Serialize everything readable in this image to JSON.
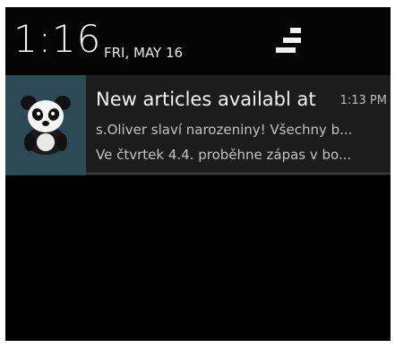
{
  "status": {
    "time": "1:16",
    "date": "FRI, MAY 16"
  },
  "notification": {
    "icon": "panda-icon",
    "title": "New articles availabl at",
    "time": "1:13 PM",
    "lines": [
      "s.Oliver slaví narozeniny! Všechny b...",
      "Ve čtvrtek 4.4. proběhne zápas v bo..."
    ]
  },
  "colors": {
    "background": "#000000",
    "notification_bg": "#1c1c1c",
    "icon_bg": "#2b4a56",
    "text_primary": "#f2f2f2",
    "text_secondary": "#c2c2c2"
  }
}
